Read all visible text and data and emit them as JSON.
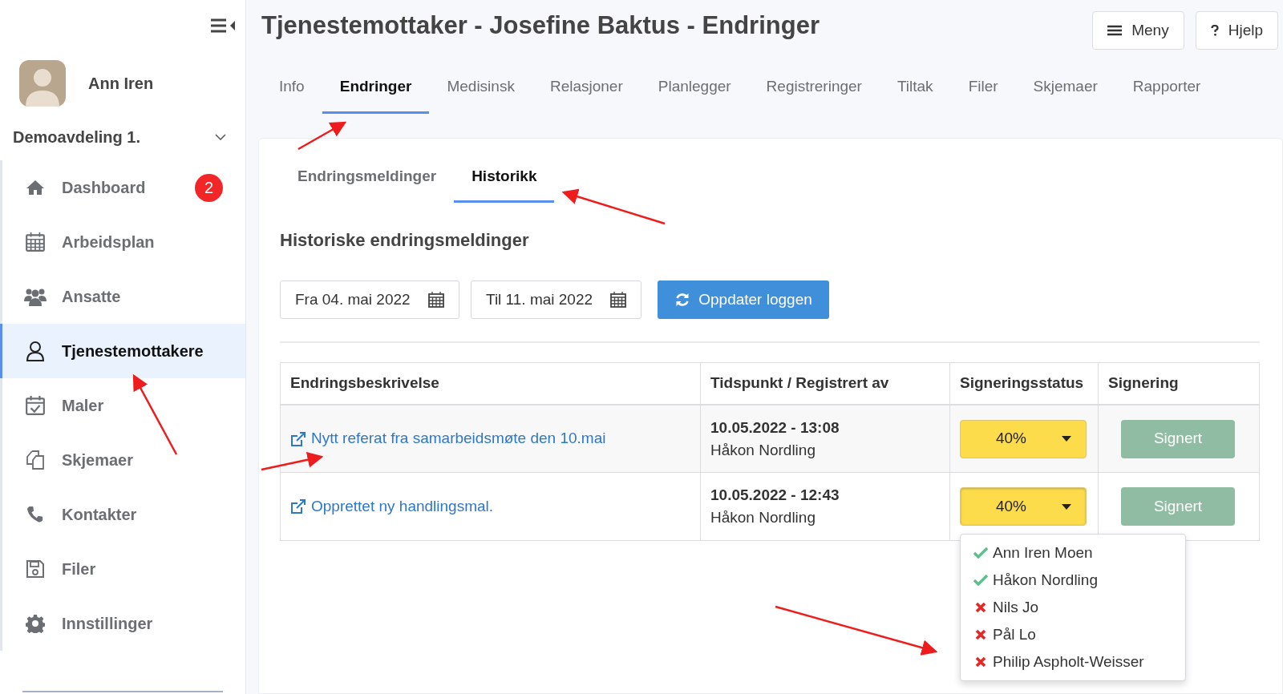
{
  "sidebar": {
    "user_name": "Ann Iren",
    "department": "Demoavdeling 1.",
    "items": [
      {
        "label": "Dashboard",
        "selected": false,
        "badge": "2"
      },
      {
        "label": "Arbeidsplan",
        "selected": false
      },
      {
        "label": "Ansatte",
        "selected": false
      },
      {
        "label": "Tjenestemottakere",
        "selected": true
      },
      {
        "label": "Maler",
        "selected": false
      },
      {
        "label": "Skjemaer",
        "selected": false
      },
      {
        "label": "Kontakter",
        "selected": false
      },
      {
        "label": "Filer",
        "selected": false
      },
      {
        "label": "Innstillinger",
        "selected": false
      }
    ]
  },
  "header": {
    "title": "Tjenestemottaker - Josefine Baktus - Endringer",
    "buttons": [
      "Meny",
      "Hjelp"
    ]
  },
  "tabs": [
    {
      "label": "Info",
      "selected": false
    },
    {
      "label": "Endringer",
      "selected": true
    },
    {
      "label": "Medisinsk",
      "selected": false
    },
    {
      "label": "Relasjoner",
      "selected": false
    },
    {
      "label": "Planlegger",
      "selected": false
    },
    {
      "label": "Registreringer",
      "selected": false
    },
    {
      "label": "Tiltak",
      "selected": false
    },
    {
      "label": "Filer",
      "selected": false
    },
    {
      "label": "Skjemaer",
      "selected": false
    },
    {
      "label": "Rapporter",
      "selected": false
    }
  ],
  "subtabs": [
    {
      "label": "Endringsmeldinger",
      "selected": false
    },
    {
      "label": "Historikk",
      "selected": true
    }
  ],
  "section_title": "Historiske endringsmeldinger",
  "date_from": "Fra 04. mai 2022",
  "date_to": "Til 11. mai 2022",
  "refresh_button": "Oppdater loggen",
  "table": {
    "columns": [
      "Endringsbeskrivelse",
      "Tidspunkt / Registrert av",
      "Signeringsstatus",
      "Signering"
    ],
    "rows": [
      {
        "description": "Nytt referat fra samarbeidsmøte den 10.mai",
        "time": "10.05.2022 - 13:08",
        "registered_by": "Håkon Nordling",
        "status": "40%",
        "sign_label": "Signert",
        "expanded": false
      },
      {
        "description": "Opprettet ny handlingsmal.",
        "time": "10.05.2022 - 12:43",
        "registered_by": "Håkon Nordling",
        "status": "40%",
        "sign_label": "Signert",
        "expanded": true,
        "signers": [
          {
            "name": "Ann Iren Moen",
            "signed": true
          },
          {
            "name": "Håkon Nordling",
            "signed": true
          },
          {
            "name": "Nils Jo",
            "signed": false
          },
          {
            "name": "Pål Lo",
            "signed": false
          },
          {
            "name": "Philip Aspholt-Weisser",
            "signed": false
          }
        ]
      }
    ]
  }
}
